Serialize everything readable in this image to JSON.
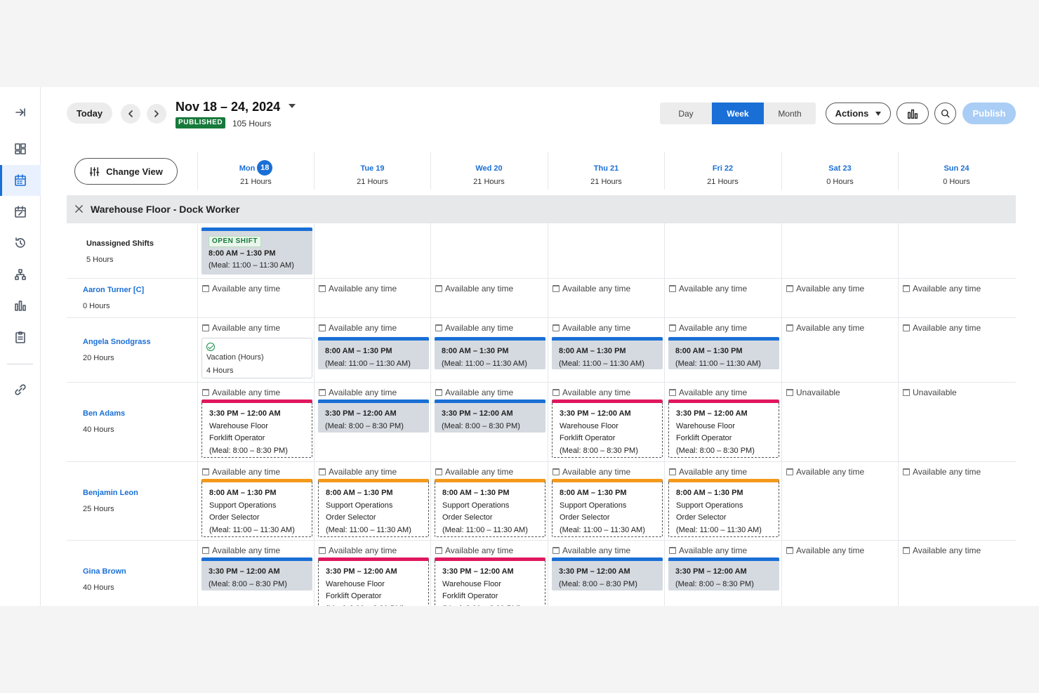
{
  "header": {
    "today_label": "Today",
    "date_range": "Nov 18 – 24, 2024",
    "status_badge": "PUBLISHED",
    "total_hours": "105 Hours",
    "views": [
      "Day",
      "Week",
      "Month"
    ],
    "active_view": "Week",
    "actions_label": "Actions",
    "publish_label": "Publish"
  },
  "sidebar": {
    "items": [
      "collapse-sidebar-icon",
      "dashboard-icon",
      "schedule-icon",
      "calendar-edit-icon",
      "time-history-icon",
      "org-chart-icon",
      "reports-icon",
      "clipboard-icon",
      "integration-icon"
    ]
  },
  "grid": {
    "change_view_label": "Change View",
    "group_title": "Warehouse Floor - Dock Worker",
    "days": [
      {
        "label": "Mon",
        "num": "18",
        "hours": "21 Hours"
      },
      {
        "label": "Tue 19",
        "hours": "21 Hours"
      },
      {
        "label": "Wed 20",
        "hours": "21 Hours"
      },
      {
        "label": "Thu 21",
        "hours": "21 Hours"
      },
      {
        "label": "Fri 22",
        "hours": "21 Hours"
      },
      {
        "label": "Sat 23",
        "hours": "0 Hours"
      },
      {
        "label": "Sun 24",
        "hours": "0 Hours"
      }
    ],
    "unassigned": {
      "name": "Unassigned Shifts",
      "hours": "5 Hours",
      "open_tag": "OPEN SHIFT",
      "time": "8:00 AM – 1:30 PM",
      "meal": "(Meal: 11:00 – 11:30 AM)"
    },
    "available_text": "Available any time",
    "unavailable_text": "Unavailable",
    "rows": {
      "aaron": {
        "name": "Aaron Turner [C]",
        "hours": "0 Hours"
      },
      "angela": {
        "name": "Angela Snodgrass",
        "hours": "20 Hours",
        "vacation_label": "Vacation (Hours)",
        "vacation_hours": "4 Hours",
        "time": "8:00 AM – 1:30 PM",
        "meal": "(Meal: 11:00 – 11:30 AM)"
      },
      "ben": {
        "name": "Ben Adams",
        "hours": "40 Hours",
        "time": "3:30 PM – 12:00 AM",
        "meal": "(Meal: 8:00 – 8:30 PM)",
        "location": "Warehouse Floor",
        "role": "Forklift Operator"
      },
      "benjamin": {
        "name": "Benjamin Leon",
        "hours": "25 Hours",
        "time": "8:00 AM – 1:30 PM",
        "meal": "(Meal: 11:00 – 11:30 AM)",
        "location": "Support Operations",
        "role": "Order Selector"
      },
      "gina": {
        "name": "Gina Brown",
        "hours": "40 Hours",
        "time": "3:30 PM – 12:00 AM",
        "meal": "(Meal: 8:00 – 8:30 PM)",
        "location": "Warehouse Floor",
        "role": "Forklift Operator"
      }
    }
  },
  "colors": {
    "accent": "#1a6fd6",
    "published": "#177a3b",
    "dashed_red": "#e0185e",
    "dashed_orange": "#f49a1a",
    "shift_bg": "#d5dae0"
  }
}
